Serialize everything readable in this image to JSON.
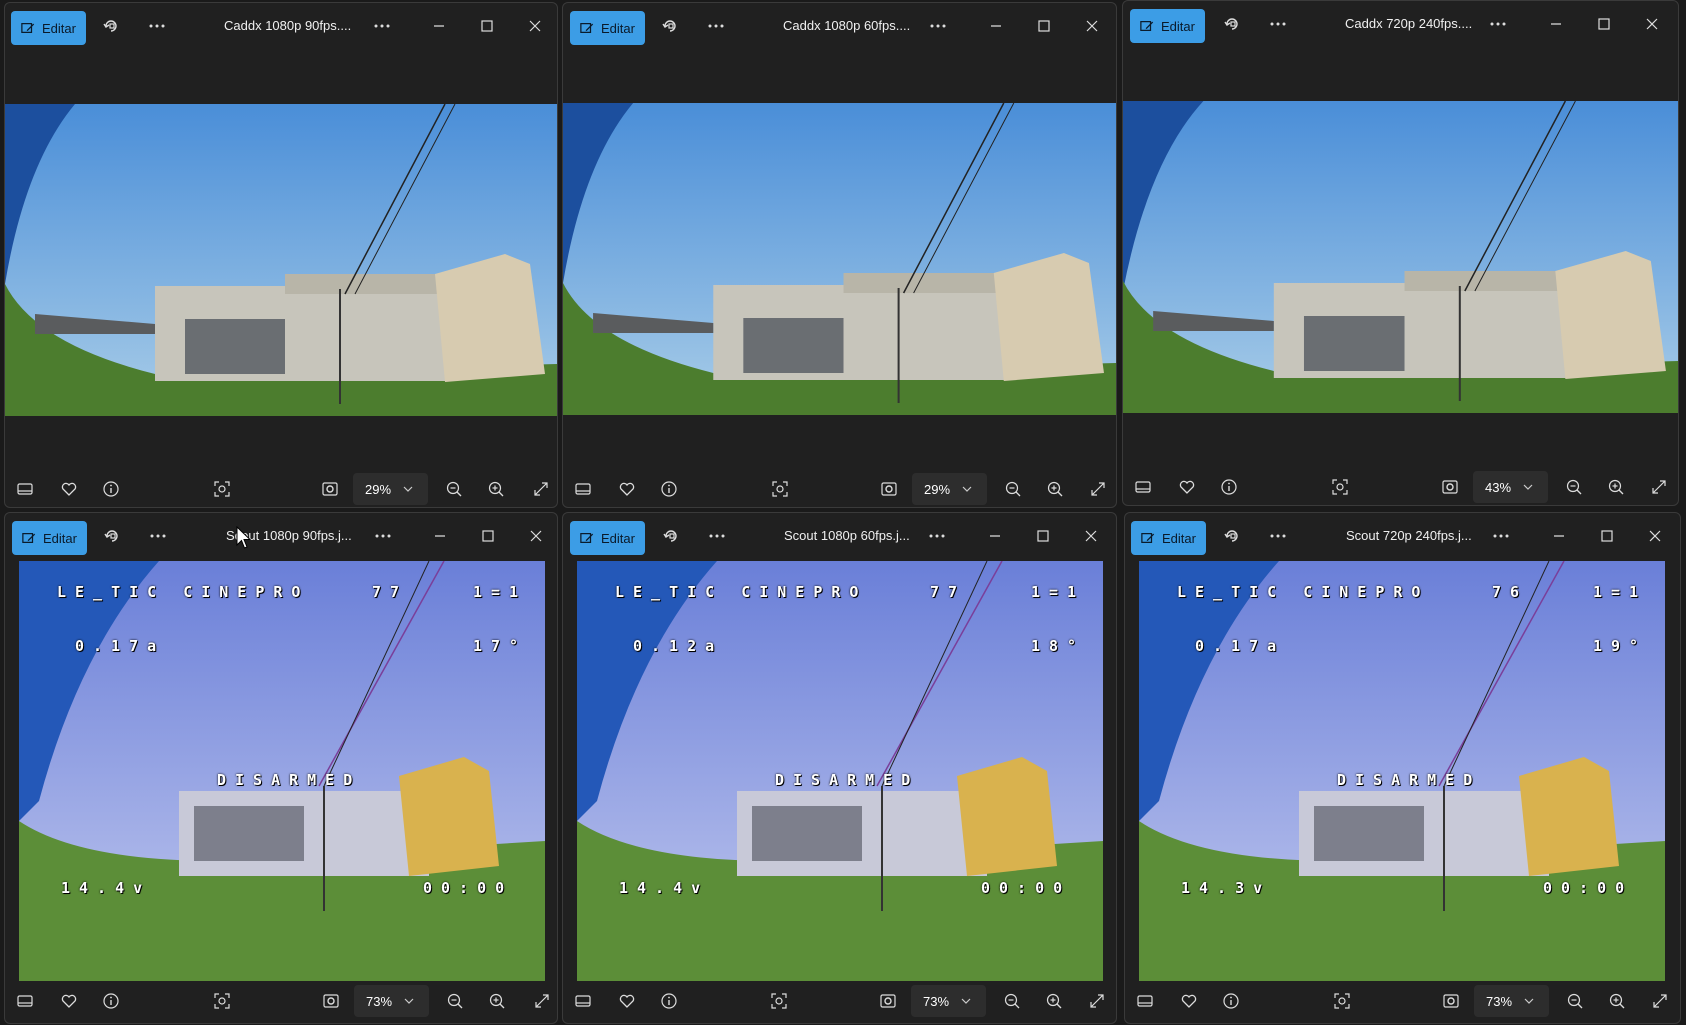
{
  "common": {
    "edit_label": "Editar",
    "icons": {
      "edit": "pencil-photo-icon",
      "rotate": "rotate-icon",
      "more": "more-icon",
      "minimize": "minimize-icon",
      "maximize": "maximize-icon",
      "close": "close-icon",
      "filmstrip": "filmstrip-icon",
      "favorite": "heart-icon",
      "info": "info-icon",
      "select": "select-region-icon",
      "fit": "fit-to-window-icon",
      "zoom_out": "zoom-out-icon",
      "zoom_in": "zoom-in-icon",
      "fullscreen": "fullscreen-icon"
    },
    "accent": "#3c9de6"
  },
  "windows": [
    {
      "title": "Caddx 1080p 90fps....",
      "zoom": "29%"
    },
    {
      "title": "Caddx 1080p 60fps....",
      "zoom": "29%"
    },
    {
      "title": "Caddx 720p 240fps....",
      "zoom": "43%"
    },
    {
      "title": "Scout 1080p 90fps.j...",
      "zoom": "73%",
      "osd": {
        "craft": "LE_TIC CINEPRO",
        "rssi": "77",
        "mode": "1=1",
        "current": "0.17a",
        "temp": "17°",
        "status": "DISARMED",
        "voltage": "14.4v",
        "timer": "00:00"
      }
    },
    {
      "title": "Scout 1080p 60fps.j...",
      "zoom": "73%",
      "osd": {
        "craft": "LE_TIC CINEPRO",
        "rssi": "77",
        "mode": "1=1",
        "current": "0.12a",
        "temp": "18°",
        "status": "DISARMED",
        "voltage": "14.4v",
        "timer": "00:00"
      }
    },
    {
      "title": "Scout 720p 240fps.j...",
      "zoom": "73%",
      "osd": {
        "craft": "LE_TIC CINEPRO",
        "rssi": "76",
        "mode": "1=1",
        "current": "0.17a",
        "temp": "19°",
        "status": "DISARMED",
        "voltage": "14.3v",
        "timer": "00:00"
      }
    }
  ]
}
